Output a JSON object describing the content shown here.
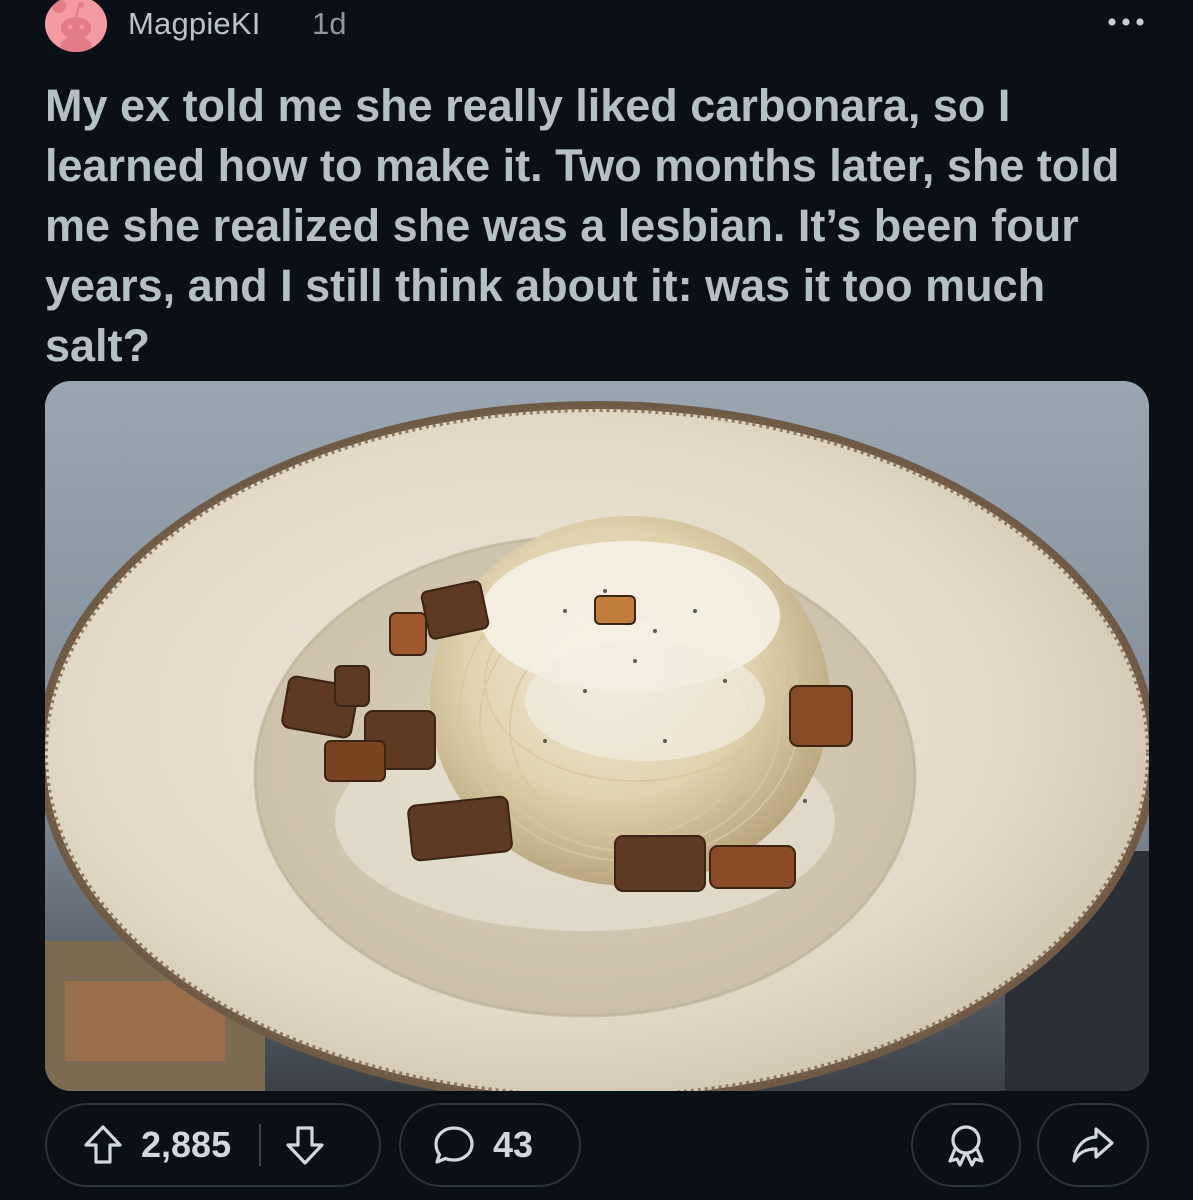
{
  "header": {
    "username": "MagpieKI",
    "age": "1d",
    "avatar_icon": "reddit-snoo-avatar-icon",
    "more_icon": "more-horizontal-icon"
  },
  "post": {
    "title": "My ex told me she really liked carbonara, so I learned how to make it. Two months later, she told me she realized she was a lesbian. It’s been four years, and I still think about it: was it too much salt?",
    "image_subject": "carbonara-plate-photo"
  },
  "actions": {
    "upvote_icon": "upvote-arrow-icon",
    "vote_count": "2,885",
    "downvote_icon": "downvote-arrow-icon",
    "comment_icon": "comment-bubble-icon",
    "comment_count": "43",
    "award_icon": "award-icon",
    "share_icon": "share-arrow-icon"
  },
  "colors": {
    "background": "#0b1016",
    "title_text": "#b3c0c7",
    "avatar": "#f39aa3",
    "pill_border": "#2a323a"
  }
}
